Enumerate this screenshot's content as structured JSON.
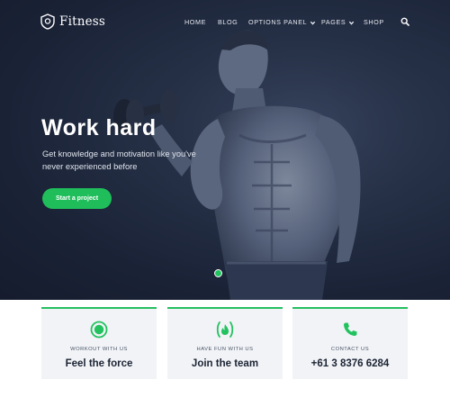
{
  "brand": {
    "name": "Fitness",
    "logo_icon": "shield-logo-icon"
  },
  "nav": {
    "items": [
      {
        "label": "HOME",
        "has_dropdown": false
      },
      {
        "label": "BLOG",
        "has_dropdown": false
      },
      {
        "label": "OPTIONS PANEL",
        "has_dropdown": true
      },
      {
        "label": "PAGES",
        "has_dropdown": true
      },
      {
        "label": "SHOP",
        "has_dropdown": false
      }
    ],
    "search_icon": "search-icon"
  },
  "hero": {
    "title": "Work hard",
    "subtitle": "Get knowledge and motivation like you've never experienced before",
    "cta_label": "Start a project",
    "slides_count": 1,
    "active_slide": 1
  },
  "features": [
    {
      "icon": "target-icon",
      "eyebrow": "WORKOUT WITH US",
      "title": "Feel the force"
    },
    {
      "icon": "fire-icon",
      "eyebrow": "HAVE FUN WITH US",
      "title": "Join the team"
    },
    {
      "icon": "phone-icon",
      "eyebrow": "CONTACT US",
      "title": "+61 3 8376 6284"
    }
  ],
  "colors": {
    "accent": "#1fbe5b",
    "hero_background": "#1a2236",
    "card_background": "#f1f3f7",
    "heading_text": "#1c2433"
  }
}
